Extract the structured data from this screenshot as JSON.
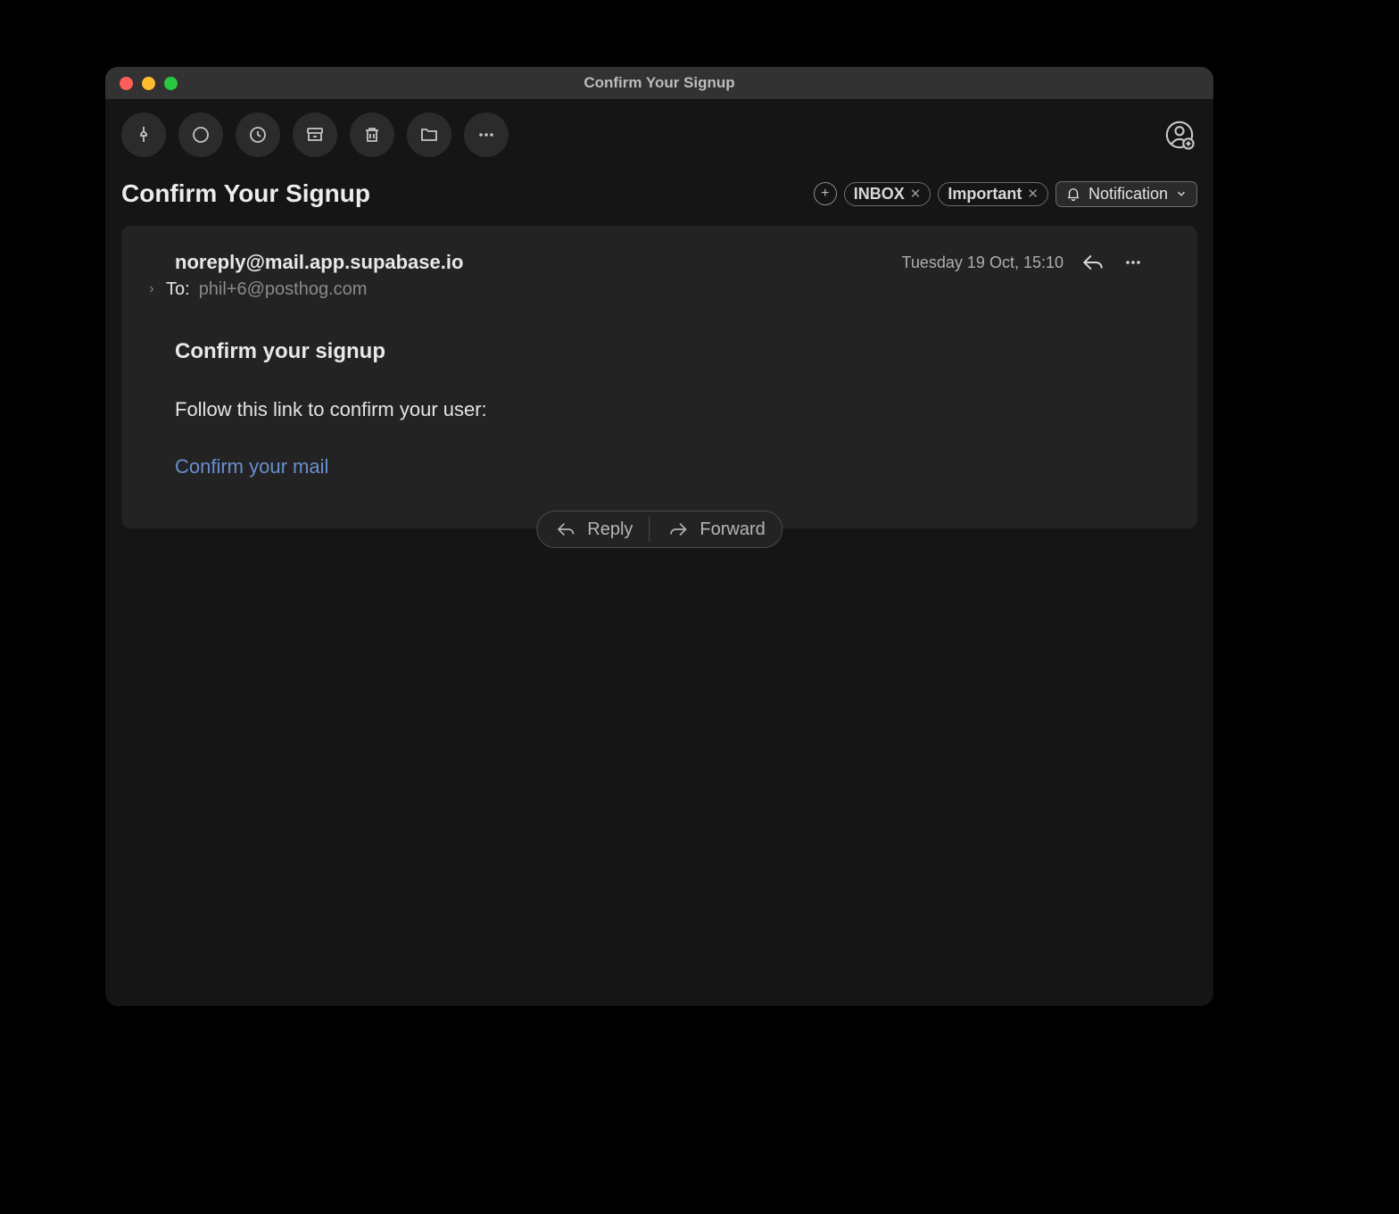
{
  "window": {
    "title": "Confirm Your Signup"
  },
  "header": {
    "subject": "Confirm Your Signup",
    "tags": [
      "INBOX",
      "Important"
    ],
    "notification_label": "Notification"
  },
  "message": {
    "from": "noreply@mail.app.supabase.io",
    "to_label": "To:",
    "to_address": "phil+6@posthog.com",
    "timestamp": "Tuesday 19 Oct, 15:10",
    "body_heading": "Confirm your signup",
    "body_text": "Follow this link to confirm your user:",
    "body_link": "Confirm your mail"
  },
  "footer": {
    "reply_label": "Reply",
    "forward_label": "Forward"
  }
}
